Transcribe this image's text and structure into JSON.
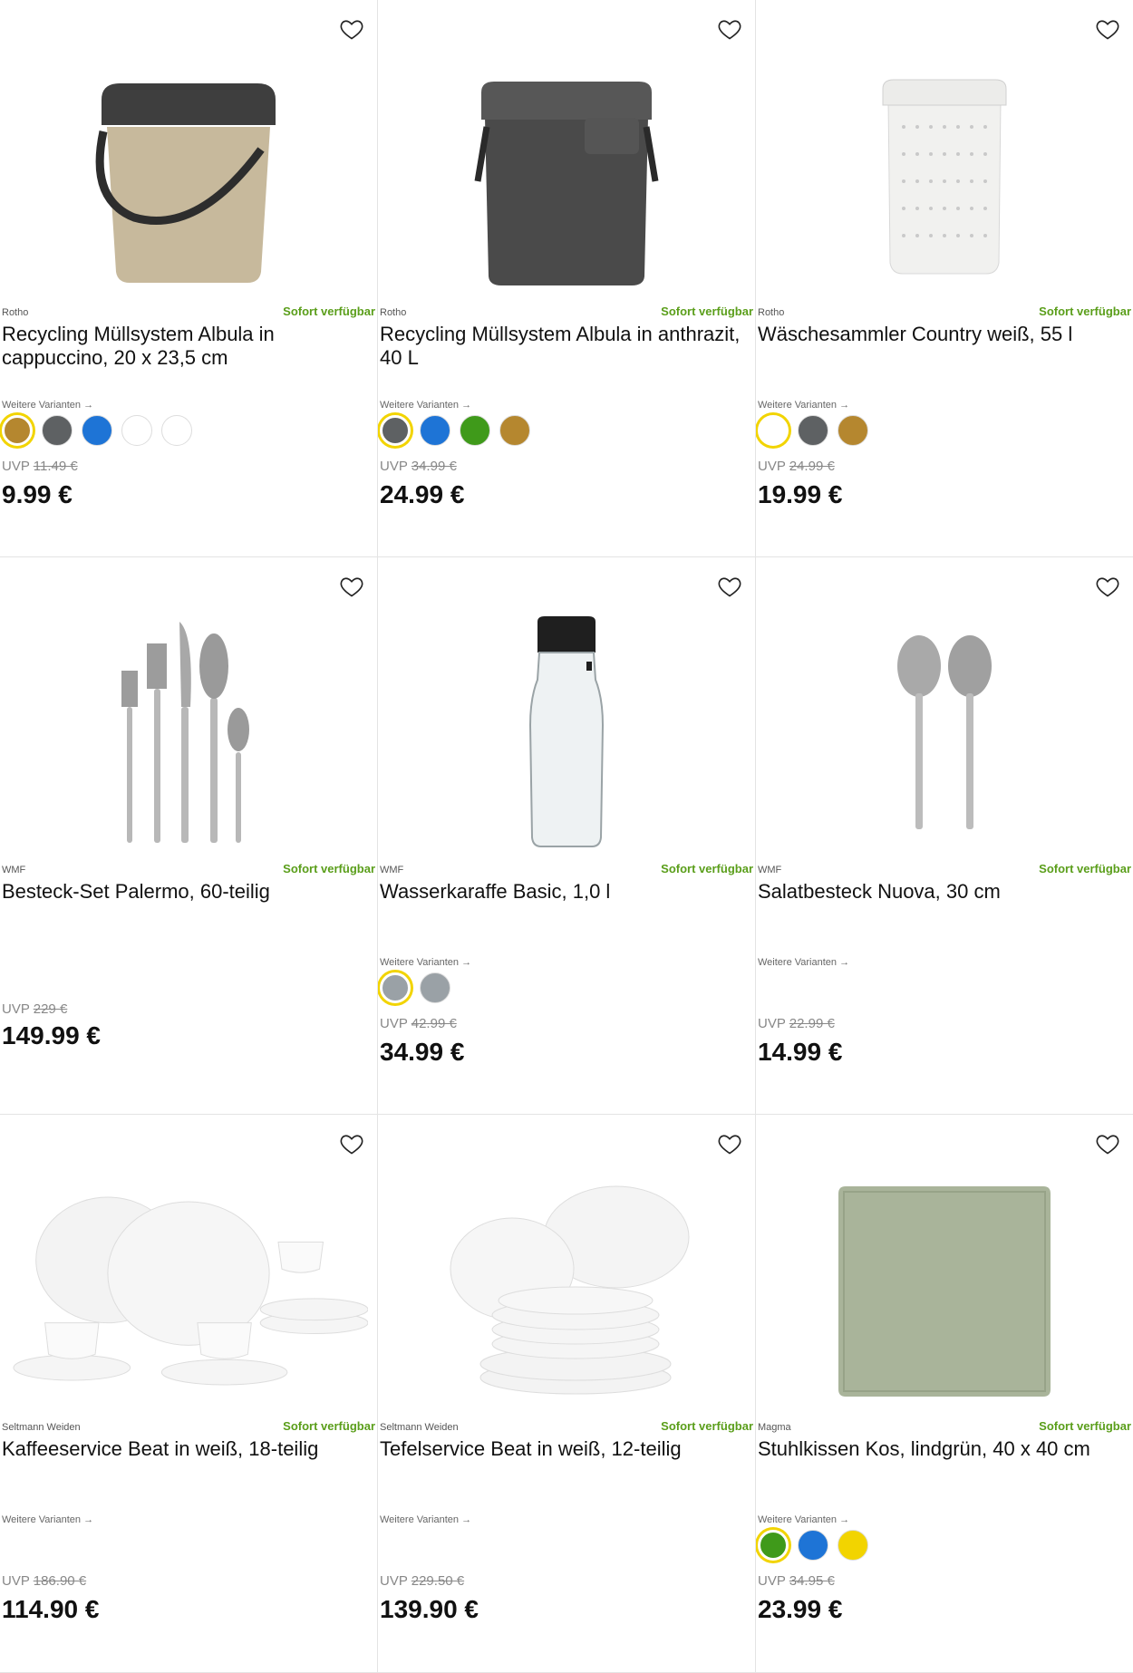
{
  "products": [
    {
      "brand": "Rotho",
      "availability": "Sofort verfügbar",
      "title": "Recycling Müllsystem Albula in cappuccino, 20 x 23,5 cm",
      "variants_label": "Weitere Varianten →",
      "swatches": [
        "#b5872f",
        "#5e6163",
        "#1e74d6",
        "#ffffff",
        "#ffffff"
      ],
      "uvp_label": "UVP",
      "uvp_value": "11.49 €",
      "price": "9.99 €"
    },
    {
      "brand": "Rotho",
      "availability": "Sofort verfügbar",
      "title": "Recycling Müllsystem Albula in anthrazit, 40 L",
      "variants_label": "Weitere Varianten →",
      "swatches": [
        "#5e6163",
        "#1e74d6",
        "#3f9a1a",
        "#b5872f"
      ],
      "uvp_label": "UVP",
      "uvp_value": "34.99 €",
      "price": "24.99 €"
    },
    {
      "brand": "Rotho",
      "availability": "Sofort verfügbar",
      "title": "Wäschesammler Country weiß, 55 l",
      "variants_label": "Weitere Varianten →",
      "swatches": [
        "#ffffff",
        "#5e6163",
        "#b5872f"
      ],
      "uvp_label": "UVP",
      "uvp_value": "24.99 €",
      "price": "19.99 €"
    },
    {
      "brand": "WMF",
      "availability": "Sofort verfügbar",
      "title": "Besteck-Set Palermo, 60-teilig",
      "variants_label": "",
      "swatches": [],
      "uvp_label": "UVP",
      "uvp_value": "229 €",
      "price": "149.99 €"
    },
    {
      "brand": "WMF",
      "availability": "Sofort verfügbar",
      "title": "Wasserkaraffe Basic, 1,0 l",
      "variants_label": "Weitere Varianten →",
      "swatches": [
        "#9aa1a6",
        "#9aa1a6"
      ],
      "uvp_label": "UVP",
      "uvp_value": "42.99 €",
      "price": "34.99 €"
    },
    {
      "brand": "WMF",
      "availability": "Sofort verfügbar",
      "title": "Salatbesteck Nuova, 30 cm",
      "variants_label": "Weitere Varianten →",
      "swatches": [],
      "uvp_label": "UVP",
      "uvp_value": "22.99 €",
      "price": "14.99 €"
    },
    {
      "brand": "Seltmann Weiden",
      "availability": "Sofort verfügbar",
      "title": "Kaffeeservice Beat in weiß, 18-teilig",
      "variants_label": "Weitere Varianten →",
      "swatches": [],
      "uvp_label": "UVP",
      "uvp_value": "186.90 €",
      "price": "114.90 €"
    },
    {
      "brand": "Seltmann Weiden",
      "availability": "Sofort verfügbar",
      "title": "Tefelservice Beat in weiß, 12-teilig",
      "variants_label": "Weitere Varianten →",
      "swatches": [],
      "uvp_label": "UVP",
      "uvp_value": "229.50 €",
      "price": "139.90 €"
    },
    {
      "brand": "Magma",
      "availability": "Sofort verfügbar",
      "title": "Stuhlkissen Kos, lindgrün, 40 x 40 cm",
      "variants_label": "Weitere Varianten →",
      "swatches": [
        "#3f9a1a",
        "#1e74d6",
        "#f2d400"
      ],
      "uvp_label": "UVP",
      "uvp_value": "34.95 €",
      "price": "23.99 €"
    }
  ]
}
